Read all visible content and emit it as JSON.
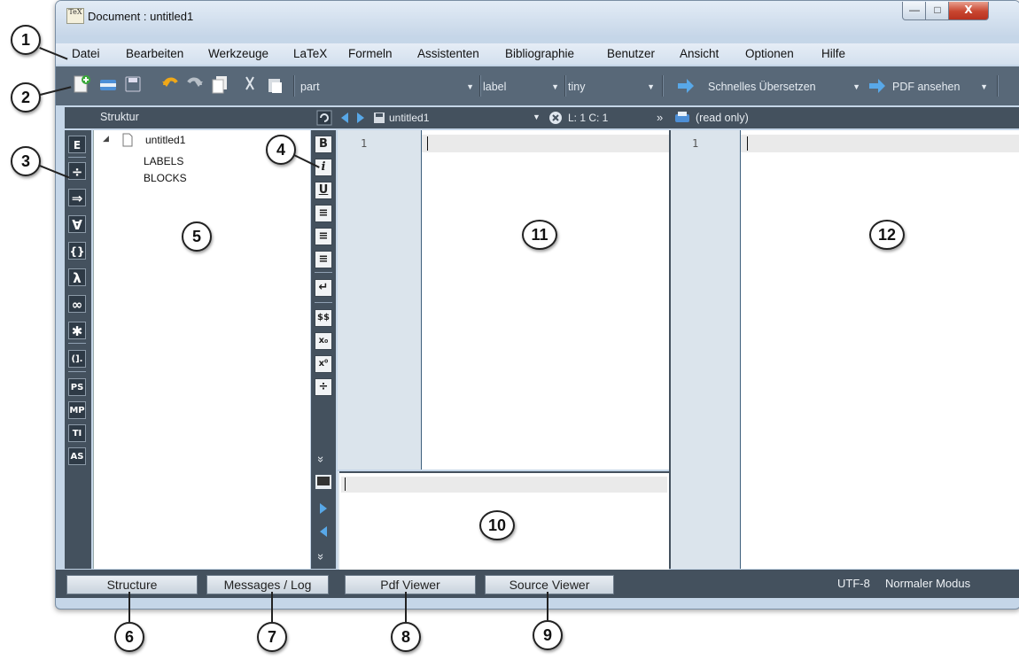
{
  "window": {
    "title": "Document : untitled1",
    "app_icon_text": "TeX",
    "minimize": "—",
    "maximize": "□",
    "close": "X"
  },
  "menu": [
    "Datei",
    "Bearbeiten",
    "Werkzeuge",
    "LaTeX",
    "Formeln",
    "Assistenten",
    "Bibliographie",
    "Benutzer",
    "Ansicht",
    "Optionen",
    "Hilfe"
  ],
  "toolbar": {
    "combo_part": "part",
    "combo_label": "label",
    "combo_size": "tiny",
    "quick_build": "Schnelles Übersetzen",
    "view_pdf": "PDF ansehen"
  },
  "structure": {
    "header": "Struktur",
    "root": "untitled1",
    "children": [
      "LABELS",
      "BLOCKS"
    ]
  },
  "structure_sidebar_icons": [
    "E",
    "÷",
    "⇒",
    "∀",
    "{}",
    "λ",
    "∞",
    "✱",
    "(].",
    "PS",
    "MP",
    "TI",
    "AS"
  ],
  "editor": {
    "filename": "untitled1",
    "position": "L: 1 C: 1",
    "overflow": "»",
    "line_number": "1",
    "format_icons": [
      "B",
      "i",
      "U",
      "≡",
      "≡",
      "≡",
      "↵",
      "$$",
      "x₀",
      "x⁰",
      "÷"
    ],
    "more_icon": "»"
  },
  "messages": {
    "line_placeholder": ""
  },
  "viewer": {
    "header": "(read only)",
    "line_number": "1"
  },
  "statusbar": {
    "tabs": [
      "Structure",
      "Messages / Log",
      "Pdf Viewer",
      "Source Viewer"
    ],
    "encoding": "UTF-8",
    "mode": "Normaler Modus"
  },
  "callouts": [
    "1",
    "2",
    "3",
    "4",
    "5",
    "6",
    "7",
    "8",
    "9",
    "10",
    "11",
    "12"
  ]
}
